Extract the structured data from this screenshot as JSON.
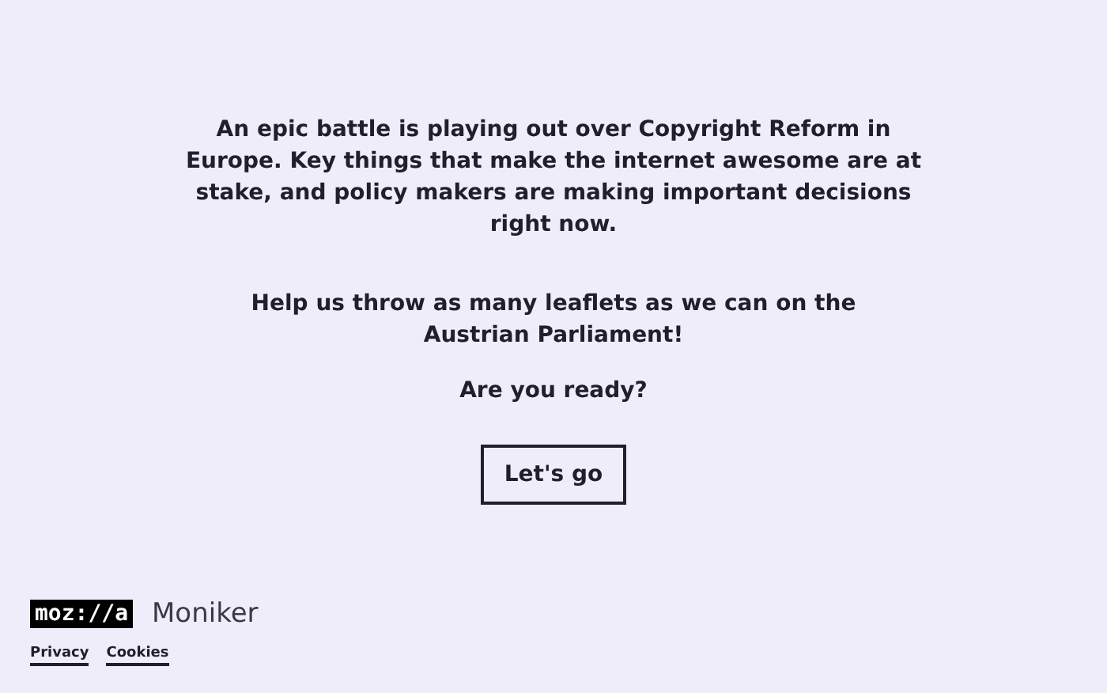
{
  "intro": [
    "An epic battle is playing out over Copyright Reform in Europe. Key things that make the internet awesome are at stake, and policy makers are making important decisions right now.",
    "Help us throw as many leaflets as we can on the Austrian Parliament!",
    "Are you ready?"
  ],
  "button": "Let's go",
  "footer": {
    "logo": "moz://a",
    "product": "Moniker",
    "links": [
      "Privacy",
      "Cookies"
    ]
  }
}
